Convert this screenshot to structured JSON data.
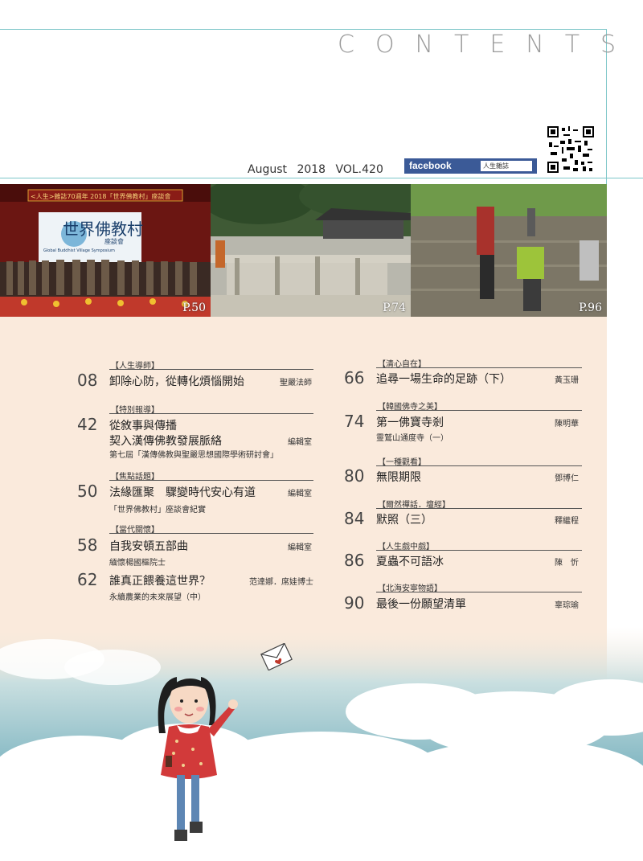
{
  "header": {
    "contents_title": "CONTENTS",
    "issue": "August  2018  VOL.420",
    "facebook_label": "facebook",
    "facebook_search_value": "人生雜誌"
  },
  "photos": [
    {
      "page": "P.50",
      "banner_text": "<人生>雜誌70週年  2018「世界佛教村」座談會",
      "board_title": "世界佛教村",
      "board_sub": "座談會",
      "board_en": "Global Buddhist Village Symposium"
    },
    {
      "page": "P.74"
    },
    {
      "page": "P.96"
    }
  ],
  "left_column": [
    {
      "label": "【人生導師】",
      "num": "08",
      "title": "卸除心防，從轉化煩惱開始",
      "author": "聖嚴法師",
      "subs": []
    },
    {
      "label": "【特別報導】",
      "num": "42",
      "title": "從敘事與傳播",
      "title2": "契入漢傳佛教發展脈絡",
      "author": "編輯室",
      "subs": [
        "第七屆「漢傳佛教與聖嚴思想國際學術研討會」"
      ]
    },
    {
      "label": "【焦點話題】",
      "num": "50",
      "title": "法緣匯聚　驟變時代安心有道",
      "author": "編輯室",
      "subs": [
        "「世界佛教村」座談會紀實"
      ]
    },
    {
      "label": "【當代關懷】",
      "num": "58",
      "title": "自我安頓五部曲",
      "author": "編輯室",
      "subs": [
        "緬懷楊國樞院士"
      ]
    },
    {
      "label": "",
      "num": "62",
      "title": "誰真正餵養這世界？",
      "author": "范達娜．席娃博士",
      "subs": [
        "永續農業的未來展望（中）"
      ]
    }
  ],
  "right_column": [
    {
      "label": "【清心自在】",
      "num": "66",
      "title": "追尋一場生命的足跡（下）",
      "author": "黃玉珊",
      "subs": []
    },
    {
      "label": "【韓國佛寺之美】",
      "num": "74",
      "title": "第一佛寶寺剎",
      "author": "陳明華",
      "subs": [
        "靈鷲山通度寺（一）"
      ]
    },
    {
      "label": "【一種觀看】",
      "num": "80",
      "title": "無限期限",
      "author": "鄧博仁",
      "subs": []
    },
    {
      "label": "【爾然禪話．壇經】",
      "num": "84",
      "title": "默照（三）",
      "author": "釋繼程",
      "subs": []
    },
    {
      "label": "【人生戲中戲】",
      "num": "86",
      "title": "夏蟲不可語冰",
      "author": "陳　忻",
      "subs": []
    },
    {
      "label": "【北海安寧物語】",
      "num": "90",
      "title": "最後一份願望清單",
      "author": "辜琮瑜",
      "subs": []
    }
  ],
  "colors": {
    "accent_line": "#7cc6c8",
    "content_bg": "#faeadc",
    "facebook": "#3b5a97",
    "sky": "#7ab4c2"
  }
}
